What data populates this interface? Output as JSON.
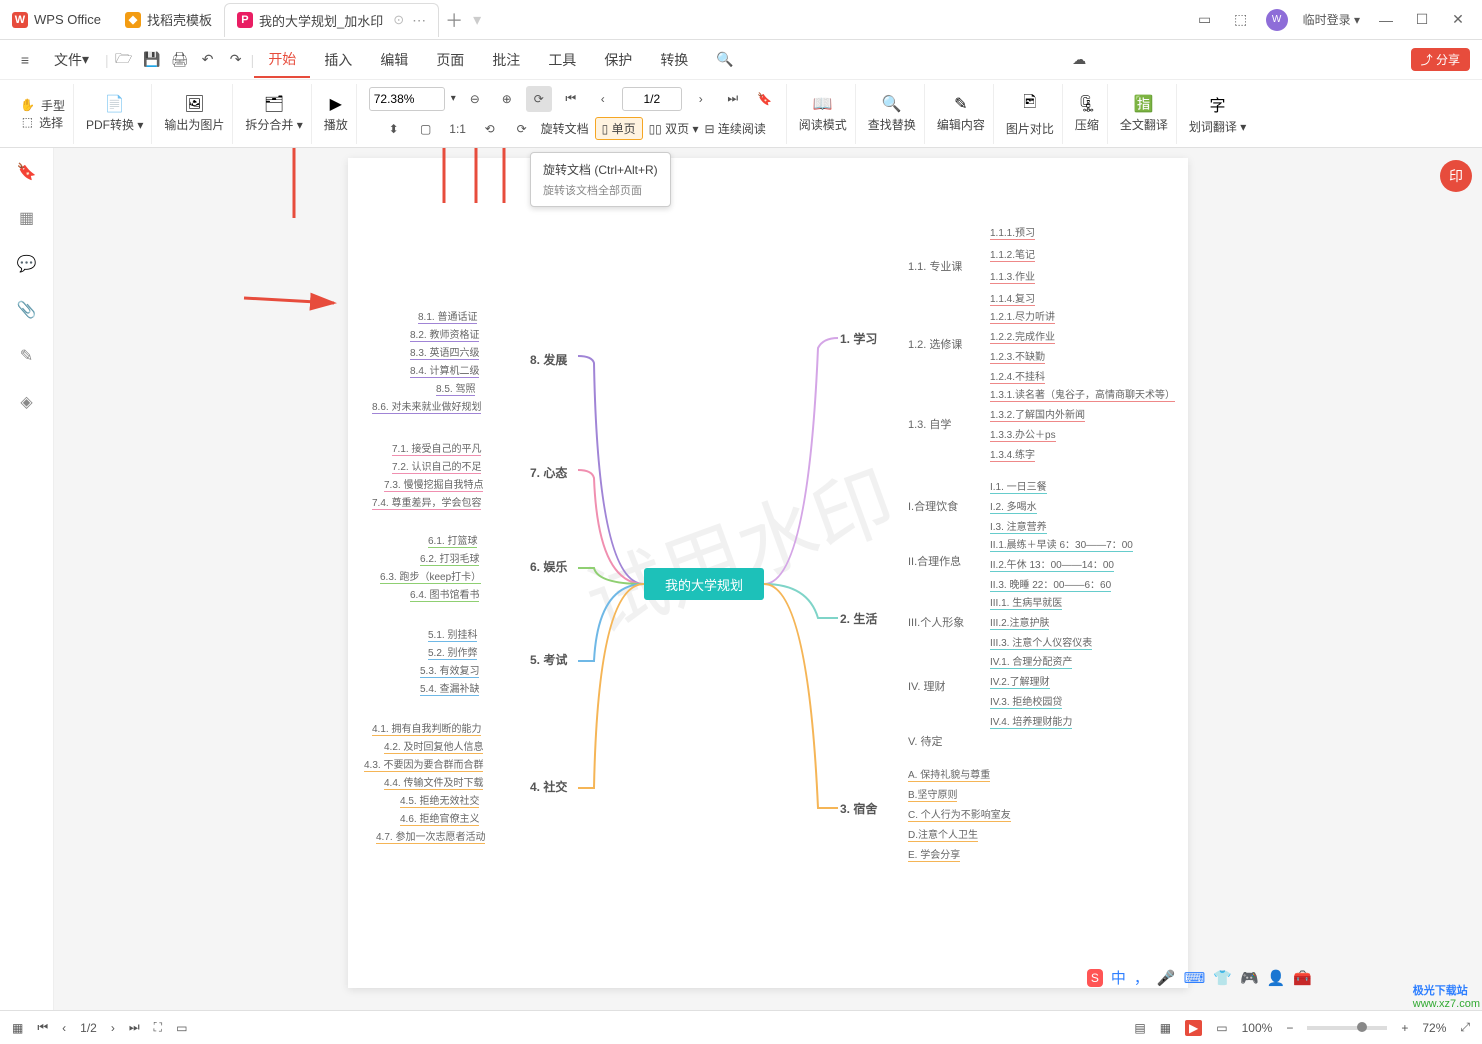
{
  "titlebar": {
    "app": "WPS Office",
    "tabs": [
      {
        "label": "找稻壳模板"
      },
      {
        "label": "我的大学规划_加水印",
        "active": true
      }
    ],
    "login": "临时登录"
  },
  "menu": {
    "file": "文件",
    "items": [
      "开始",
      "插入",
      "编辑",
      "页面",
      "批注",
      "工具",
      "保护",
      "转换"
    ],
    "search": "🔍",
    "share": "分享"
  },
  "ribbon": {
    "hand": "手型",
    "select": "选择",
    "pdfconv": "PDF转换",
    "exportimg": "输出为图片",
    "split": "拆分合并",
    "play": "播放",
    "zoom": "72.38%",
    "page": "1/2",
    "rotate": "旋转文档",
    "single": "单页",
    "dual": "双页",
    "cont": "连续阅读",
    "read": "阅读模式",
    "find": "查找替换",
    "edit": "编辑内容",
    "compare": "图片对比",
    "compress": "压缩",
    "fulltrans": "全文翻译",
    "wordtrans": "划词翻译"
  },
  "tooltip": {
    "title": "旋转文档 (Ctrl+Alt+R)",
    "desc": "旋转该文档全部页面"
  },
  "mindmap": {
    "center": "我的大学规划",
    "watermark": "试用水印",
    "r1": {
      "t": "1. 学习",
      "c": [
        {
          "t": "1.1. 专业课",
          "leaf": [
            "1.1.1.预习",
            "1.1.2.笔记",
            "1.1.3.作业",
            "1.1.4.复习"
          ]
        },
        {
          "t": "1.2. 选修课",
          "leaf": [
            "1.2.1.尽力听讲",
            "1.2.2.完成作业",
            "1.2.3.不缺勤",
            "1.2.4.不挂科"
          ]
        },
        {
          "t": "1.3. 自学",
          "leaf": [
            "1.3.1.读名著（鬼谷子，高情商聊天术等）",
            "1.3.2.了解国内外新闻",
            "1.3.3.办公＋ps",
            "1.3.4.练字"
          ]
        }
      ]
    },
    "r2": {
      "t": "2. 生活",
      "c": [
        {
          "t": "I.合理饮食",
          "leaf": [
            "I.1. 一日三餐",
            "I.2. 多喝水",
            "I.3. 注意营养"
          ]
        },
        {
          "t": "II.合理作息",
          "leaf": [
            "II.1.晨练＋早读 6：30——7：00",
            "II.2.午休 13：00——14：00",
            "II.3. 晚睡 22：00——6：60"
          ]
        },
        {
          "t": "III.个人形象",
          "leaf": [
            "III.1. 生病早就医",
            "III.2.注意护肤",
            "III.3. 注意个人仪容仪表"
          ]
        },
        {
          "t": "IV. 理财",
          "leaf": [
            "IV.1. 合理分配资产",
            "IV.2.了解理财",
            "IV.3. 拒绝校园贷",
            "IV.4. 培养理财能力"
          ]
        },
        {
          "t": "V. 待定",
          "leaf": []
        }
      ]
    },
    "r3": {
      "t": "3. 宿舍",
      "c": [
        {
          "t": "A. 保持礼貌与尊重"
        },
        {
          "t": "B.坚守原则"
        },
        {
          "t": "C. 个人行为不影响室友"
        },
        {
          "t": "D.注意个人卫生"
        },
        {
          "t": "E. 学会分享"
        }
      ]
    },
    "l8": {
      "t": "8. 发展",
      "c": [
        "8.1. 普通话证",
        "8.2. 教师资格证",
        "8.3. 英语四六级",
        "8.4. 计算机二级",
        "8.5. 驾照",
        "8.6. 对未来就业做好规划"
      ]
    },
    "l7": {
      "t": "7. 心态",
      "c": [
        "7.1. 接受自己的平凡",
        "7.2. 认识自己的不足",
        "7.3. 慢慢挖掘自我特点",
        "7.4. 尊重差异，学会包容"
      ]
    },
    "l6": {
      "t": "6. 娱乐",
      "c": [
        "6.1. 打篮球",
        "6.2. 打羽毛球",
        "6.3. 跑步（keep打卡）",
        "6.4. 图书馆看书"
      ]
    },
    "l5": {
      "t": "5. 考试",
      "c": [
        "5.1. 别挂科",
        "5.2. 别作弊",
        "5.3. 有效复习",
        "5.4. 查漏补缺"
      ]
    },
    "l4": {
      "t": "4. 社交",
      "c": [
        "4.1. 拥有自我判断的能力",
        "4.2. 及时回复他人信息",
        "4.3. 不要因为要合群而合群",
        "4.4. 传输文件及时下载",
        "4.5. 拒绝无效社交",
        "4.6. 拒绝官僚主义",
        "4.7. 参加一次志愿者活动"
      ]
    }
  },
  "status": {
    "page": "1/2",
    "scale": "100%",
    "zoom": "72%",
    "site1": "极光下载站",
    "site2": "www.xz7.com"
  }
}
